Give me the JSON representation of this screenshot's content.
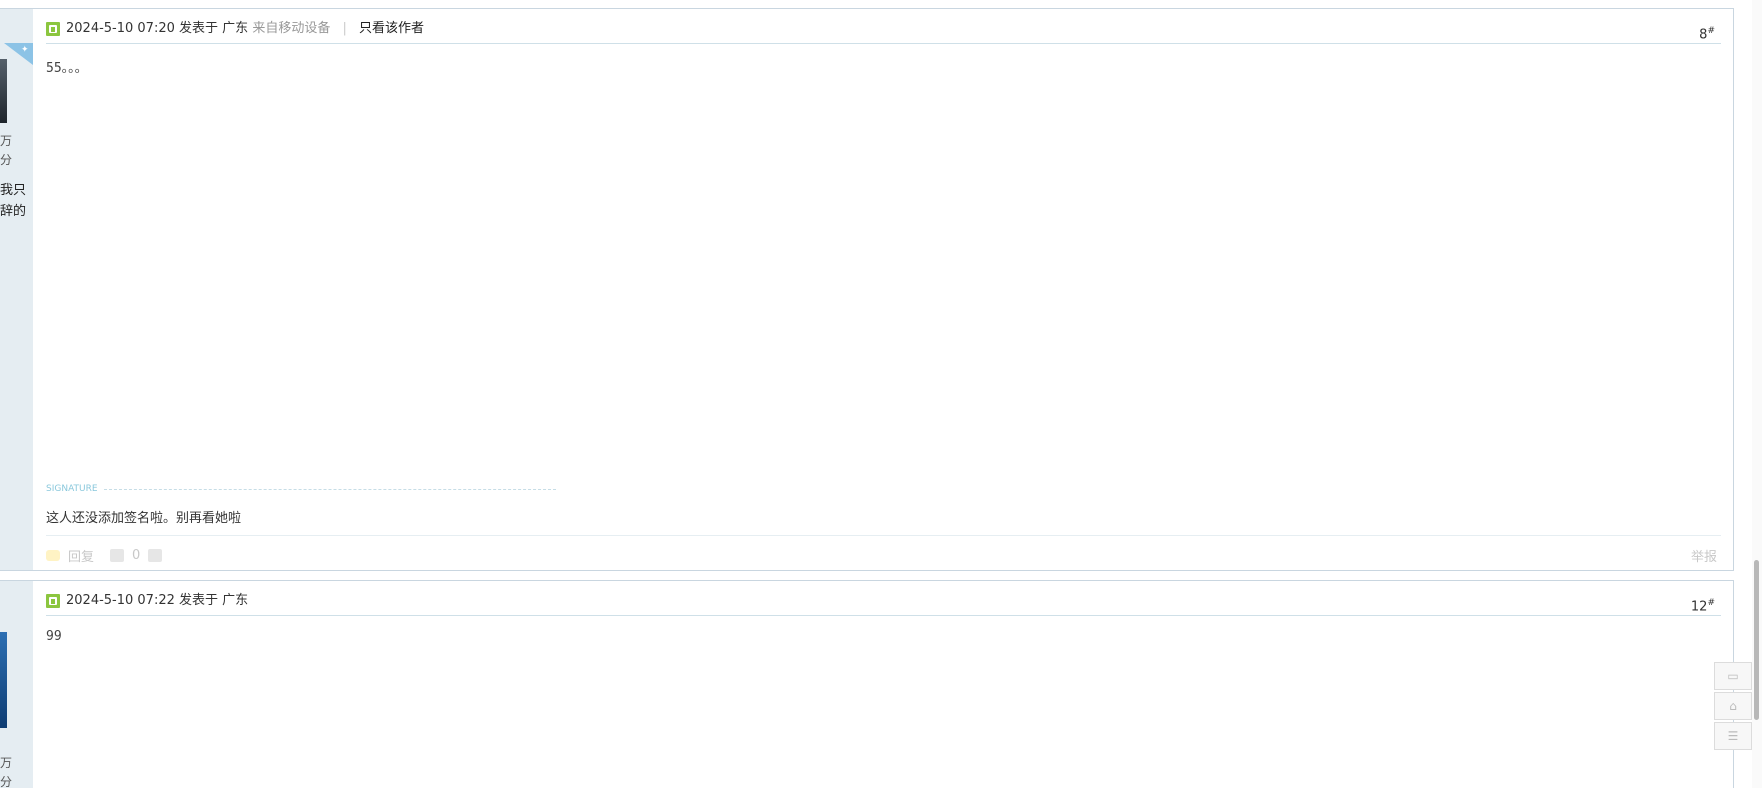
{
  "posts": [
    {
      "author_lines": [
        "万",
        "分"
      ],
      "author_extra": [
        "我只",
        "辞的"
      ],
      "timestamp": "2024-5-10 07:20",
      "posted_label": "发表于",
      "location": "广东",
      "device": "来自移动设备",
      "separator": "|",
      "only_author_link": "只看该作者",
      "floor": "8",
      "floor_mark": "#",
      "body": "55。。。",
      "signature_label": "SIGNATURE",
      "signature_text": "这人还没添加签名啦。别再看她啦",
      "reply_label": "回复",
      "like_count": "0",
      "report_label": "举报"
    },
    {
      "author_lines": [
        "万",
        "分"
      ],
      "timestamp": "2024-5-10 07:22",
      "posted_label": "发表于",
      "location": "广东",
      "floor": "12",
      "floor_mark": "#",
      "body": "99"
    }
  ],
  "side_tools": {
    "comment_icon": "comment-icon",
    "top_icon": "back-to-top-icon",
    "list_icon": "list-icon"
  },
  "colors": {
    "accent": "#8cc63f",
    "author_bg": "#e5edf2",
    "link_blue": "#8ac8dc"
  }
}
